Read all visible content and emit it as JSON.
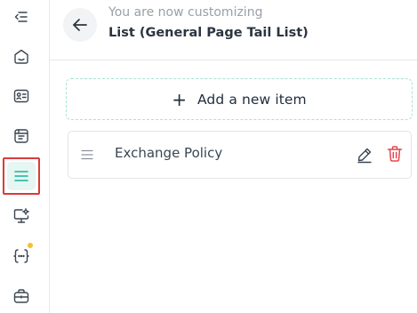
{
  "header": {
    "subtitle": "You are now customizing",
    "title": "List (General Page Tail List)"
  },
  "add_item": {
    "plus": "+",
    "label": "Add a new item"
  },
  "list": {
    "items": [
      {
        "label": "Exchange Policy"
      }
    ]
  },
  "sidebar": {
    "items": [
      {
        "icon": "collapse-icon"
      },
      {
        "icon": "home-icon"
      },
      {
        "icon": "id-card-icon"
      },
      {
        "icon": "page-layout-icon"
      },
      {
        "icon": "list-icon",
        "active": true
      },
      {
        "icon": "monitor-settings-icon"
      },
      {
        "icon": "code-braces-icon",
        "notification": true
      },
      {
        "icon": "briefcase-icon"
      }
    ]
  },
  "colors": {
    "accent": "#17b39a",
    "active_bg": "#e6f6f3",
    "highlight_border": "#d93a3a",
    "delete": "#e5484d",
    "notification_dot": "#f2c12e"
  }
}
